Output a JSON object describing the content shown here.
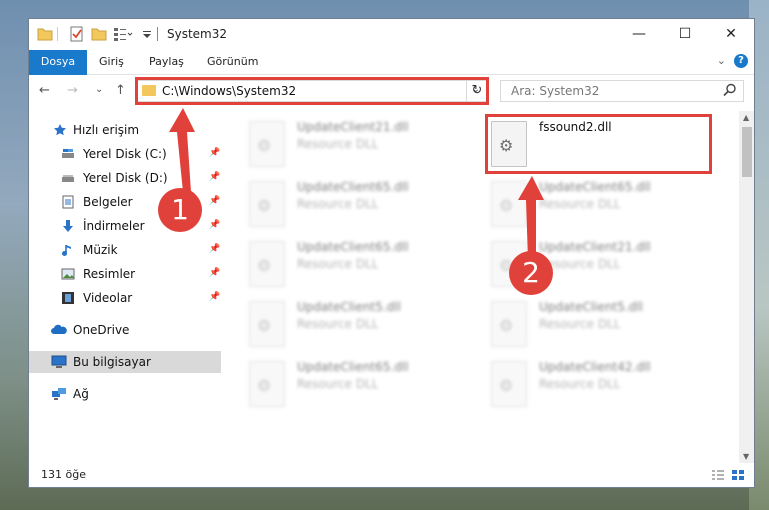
{
  "window": {
    "title": "System32",
    "controls": {
      "minimize": "—",
      "maximize": "☐",
      "close": "✕"
    }
  },
  "ribbon": {
    "tabs": [
      "Dosya",
      "Giriş",
      "Paylaş",
      "Görünüm"
    ],
    "expand": "⌄",
    "help": "?"
  },
  "nav": {
    "back": "←",
    "forward": "→",
    "recent": "⌄",
    "up": "↑",
    "address": "C:\\Windows\\System32",
    "address_drop": "⌄",
    "refresh": "↻",
    "search_placeholder": "Ara: System32"
  },
  "sidebar": {
    "items": [
      {
        "label": "Hızlı erişim",
        "icon": "star-icon"
      },
      {
        "label": "Yerel Disk (C:)",
        "icon": "drive-icon",
        "pinned": true
      },
      {
        "label": "Yerel Disk (D:)",
        "icon": "drive-icon",
        "pinned": true
      },
      {
        "label": "Belgeler",
        "icon": "documents-icon",
        "pinned": true
      },
      {
        "label": "İndirmeler",
        "icon": "download-icon",
        "pinned": true
      },
      {
        "label": "Müzik",
        "icon": "music-icon",
        "pinned": true
      },
      {
        "label": "Resimler",
        "icon": "pictures-icon",
        "pinned": true
      },
      {
        "label": "Videolar",
        "icon": "video-icon",
        "pinned": true
      },
      {
        "label": "OneDrive",
        "icon": "cloud-icon"
      },
      {
        "label": "Bu bilgisayar",
        "icon": "computer-icon",
        "selected": true
      },
      {
        "label": "Ağ",
        "icon": "network-icon"
      }
    ],
    "pin_glyph": "📌"
  },
  "files": {
    "highlighted": {
      "name": "fssound2.dll",
      "type": ""
    },
    "left_column": [
      {
        "name": "UpdateClient21.dll",
        "type": "Resource DLL"
      },
      {
        "name": "UpdateClient65.dll",
        "type": "Resource DLL"
      },
      {
        "name": "UpdateClient65.dll",
        "type": "Resource DLL"
      },
      {
        "name": "UpdateClient5.dll",
        "type": "Resource DLL"
      },
      {
        "name": "UpdateClient65.dll",
        "type": "Resource DLL"
      }
    ],
    "right_column": [
      {
        "name": "UpdateClient65.dll",
        "type": "Resource DLL"
      },
      {
        "name": "UpdateClient21.dll",
        "type": "Resource DLL"
      },
      {
        "name": "UpdateClient5.dll",
        "type": "Resource DLL"
      },
      {
        "name": "UpdateClient42.dll",
        "type": "Resource DLL"
      }
    ]
  },
  "status": {
    "count": "131 öğe"
  },
  "annotations": {
    "step1": "1",
    "step2": "2",
    "color": "#e0413a"
  }
}
